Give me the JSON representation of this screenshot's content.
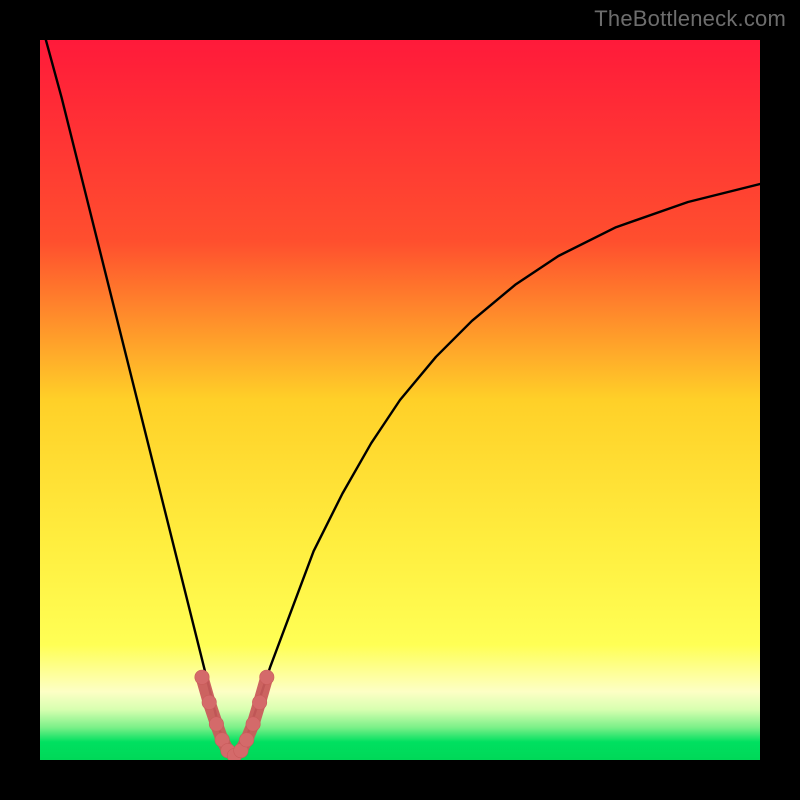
{
  "watermark": "TheBottleneck.com",
  "colors": {
    "frame": "#000000",
    "gradient_top": "#ff1a3a",
    "gradient_mid_upper": "#ff6a2a",
    "gradient_mid": "#ffd028",
    "gradient_mid_lower": "#ffff55",
    "gradient_pale": "#fdffc5",
    "gradient_green": "#00e060",
    "curve_color": "#000000",
    "marker_fill": "#d46a6a",
    "marker_stroke": "#c95b5b"
  },
  "chart_data": {
    "type": "line",
    "title": "",
    "xlabel": "",
    "ylabel": "",
    "xlim": [
      0,
      100
    ],
    "ylim": [
      0,
      100
    ],
    "x_of_minimum": 27,
    "series": [
      {
        "name": "curve",
        "x": [
          0,
          3,
          6,
          9,
          12,
          15,
          18,
          20,
          22,
          24,
          25,
          26,
          27,
          28,
          29,
          30,
          32,
          35,
          38,
          42,
          46,
          50,
          55,
          60,
          66,
          72,
          80,
          90,
          100
        ],
        "y": [
          103,
          92,
          80,
          68,
          56,
          44,
          32,
          24,
          16,
          8,
          4,
          1.5,
          0.5,
          1.5,
          4,
          7,
          13,
          21,
          29,
          37,
          44,
          50,
          56,
          61,
          66,
          70,
          74,
          77.5,
          80
        ]
      },
      {
        "name": "highlight",
        "x": [
          22.5,
          23.5,
          24.5,
          25.3,
          26.1,
          27.0,
          27.9,
          28.7,
          29.6,
          30.5,
          31.5
        ],
        "y": [
          11.5,
          8.0,
          5.0,
          2.8,
          1.3,
          0.6,
          1.3,
          2.8,
          5.0,
          8.0,
          11.5
        ]
      }
    ]
  }
}
